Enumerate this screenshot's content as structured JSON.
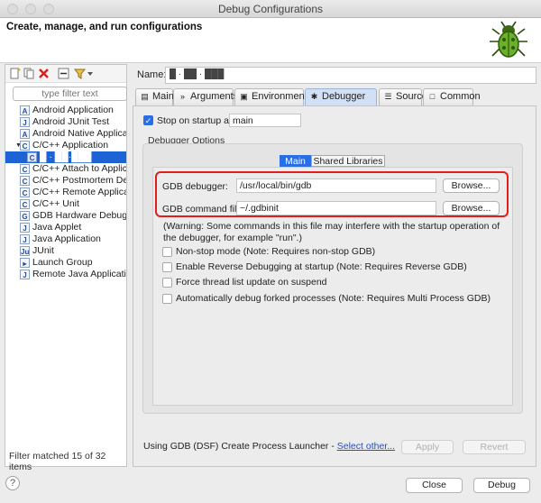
{
  "window": {
    "title": "Debug Configurations"
  },
  "header": {
    "title": "Create, manage, and run configurations",
    "icon": "green-bug-icon"
  },
  "left": {
    "filter_placeholder": "type filter text",
    "tree": [
      {
        "label": "Android Application",
        "icon": "A",
        "indent": 1
      },
      {
        "label": "Android JUnit Test",
        "icon": "J",
        "indent": 1
      },
      {
        "label": "Android Native Applicatic",
        "icon": "A",
        "indent": 1
      },
      {
        "label": "C/C++ Application",
        "icon": "C",
        "indent": 1,
        "expanded": true
      },
      {
        "label": "█ · ██·███",
        "icon": "C",
        "indent": 2,
        "selected": true
      },
      {
        "label": "C/C++ Attach to Applicat",
        "icon": "C",
        "indent": 1
      },
      {
        "label": "C/C++ Postmortem Debu",
        "icon": "C",
        "indent": 1
      },
      {
        "label": "C/C++ Remote Applicatic",
        "icon": "C",
        "indent": 1
      },
      {
        "label": "C/C++ Unit",
        "icon": "C",
        "indent": 1
      },
      {
        "label": "GDB Hardware Debuggin",
        "icon": "G",
        "indent": 1
      },
      {
        "label": "Java Applet",
        "icon": "J",
        "indent": 1
      },
      {
        "label": "Java Application",
        "icon": "J",
        "indent": 1
      },
      {
        "label": "JUnit",
        "icon": "Ju",
        "indent": 1
      },
      {
        "label": "Launch Group",
        "icon": "▸",
        "indent": 1
      },
      {
        "label": "Remote Java Application",
        "icon": "J",
        "indent": 1
      }
    ],
    "status": "Filter matched 15 of 32 items"
  },
  "right": {
    "name_label": "Name:",
    "name_value": "█ · ██ · ███",
    "tabs": [
      {
        "label": "Main",
        "icon": "▤"
      },
      {
        "label": "Arguments",
        "icon": "»"
      },
      {
        "label": "Environment",
        "icon": "▣"
      },
      {
        "label": "Debugger",
        "icon": "✱",
        "active": true
      },
      {
        "label": "Source",
        "icon": "☰"
      },
      {
        "label": "Common",
        "icon": "□"
      }
    ],
    "stop_on_startup": {
      "label": "Stop on startup at:",
      "checked": true,
      "value": "main"
    },
    "debugger_options_label": "Debugger Options",
    "subtabs": [
      {
        "label": "Main",
        "active": true
      },
      {
        "label": "Shared Libraries",
        "active": false
      }
    ],
    "gdb_debugger": {
      "label": "GDB debugger:",
      "value": "/usr/local/bin/gdb",
      "browse": "Browse..."
    },
    "gdb_command_file": {
      "label": "GDB command file:",
      "value": "~/.gdbinit",
      "browse": "Browse..."
    },
    "warning": "(Warning: Some commands in this file may interfere with the startup operation of the debugger, for example \"run\".)",
    "options": [
      {
        "label": "Non-stop mode (Note: Requires non-stop GDB)",
        "checked": false
      },
      {
        "label": "Enable Reverse Debugging at startup (Note: Requires Reverse GDB)",
        "checked": false
      },
      {
        "label": "Force thread list update on suspend",
        "checked": false
      },
      {
        "label": "Automatically debug forked processes (Note: Requires Multi Process GDB)",
        "checked": false
      }
    ],
    "launcher_text": "Using GDB (DSF) Create Process Launcher - ",
    "launcher_link": "Select other...",
    "apply": "Apply",
    "revert": "Revert"
  },
  "footer": {
    "help": "?",
    "close": "Close",
    "debug": "Debug"
  },
  "colors": {
    "accent": "#2a6ee6",
    "selection": "#1e63d6",
    "highlight_border": "#e21d1d",
    "link": "#1a4ee0"
  }
}
